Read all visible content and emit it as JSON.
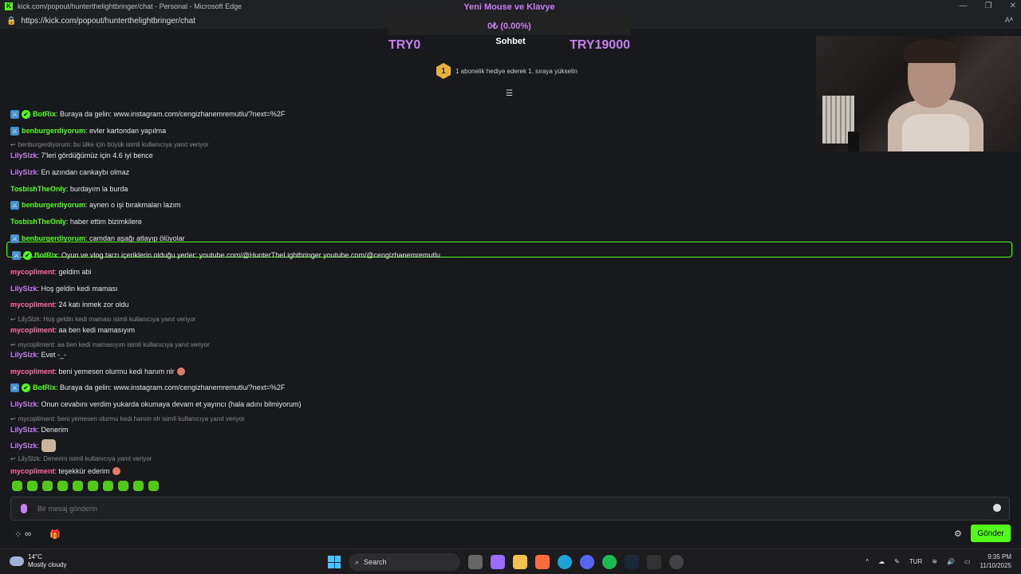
{
  "window": {
    "title": "kick.com/popout/hunterthelightbringer/chat - Personal - Microsoft Edge",
    "url": "https://kick.com/popout/hunterthelightbringer/chat"
  },
  "goal": {
    "title": "Yeni Mouse ve Klavye",
    "percent_text": "0₺ (0.00%)",
    "min_label": "TRY0",
    "max_label": "TRY19000",
    "progress": 0
  },
  "chat": {
    "title": "Sohbet",
    "sub_promo_rank": "1",
    "sub_promo_text": "1 abonelik hediye ederek 1. sıraya yükselin"
  },
  "messages": [
    {
      "user": "BotRix",
      "text": ": Buraya da gelin: www.instagram.com/cengizhanemremutlu/?next=%2F",
      "color": "#53fc18",
      "badges": [
        "mod",
        "verified"
      ]
    },
    {
      "user": "benburgerdiyorum",
      "text": ": evler kartondan yapılma",
      "color": "#53fc18",
      "badges": [
        "mod"
      ]
    },
    {
      "reply": "benburgerdiyorum: bu ülke için büyük isimli kullanıcıya yanıt veriyor"
    },
    {
      "user": "LilySlzk",
      "text": ": 7'leri gördüğümüz için 4.6 iyi bence",
      "color": "#c67ff0",
      "badges": []
    },
    {
      "user": "LilySlzk",
      "text": ": En azından cankaybı olmaz",
      "color": "#c67ff0",
      "badges": []
    },
    {
      "user": "TosbishTheOnly",
      "text": ": burdayım la burda",
      "color": "#53fc18",
      "badges": []
    },
    {
      "user": "benburgerdiyorum",
      "text": ": aynen o işi bırakmaları lazım",
      "color": "#53fc18",
      "badges": [
        "mod"
      ]
    },
    {
      "user": "TosbishTheOnly",
      "text": ": haber ettim bizimkilere",
      "color": "#53fc18",
      "badges": []
    },
    {
      "user": "benburgerdiyorum",
      "text": ": camdan aşağı atlayıp ölüyolar",
      "color": "#53fc18",
      "badges": [
        "mod"
      ]
    },
    {
      "user": "BotRix",
      "text": ": Oyun ve vlog tarzı içeriklerin olduğu yerler: youtube.com/@HunterTheLightbringer youtube.com/@cengizhanemremutlu",
      "color": "#53fc18",
      "badges": [
        "mod",
        "verified"
      ],
      "pinned": true
    },
    {
      "user": "mycopliment",
      "text": ": geldim abi",
      "color": "#ff6b9d",
      "badges": []
    },
    {
      "user": "LilySlzk",
      "text": ": Hoş geldin kedi maması",
      "color": "#c67ff0",
      "badges": []
    },
    {
      "user": "mycopliment",
      "text": ": 24 katı inmek zor oldu",
      "color": "#ff6b9d",
      "badges": []
    },
    {
      "reply": "LilySlzk: Hoş geldin kedi maması isimli kullanıcıya yanıt veriyor"
    },
    {
      "user": "mycopliment",
      "text": ": aa ben kedi mamasıyım",
      "color": "#ff6b9d",
      "badges": []
    },
    {
      "reply": "mycopliment: aa ben kedi mamasıyım isimli kullanıcıya yanıt veriyor"
    },
    {
      "user": "LilySlzk",
      "text": ": Evet -_-",
      "color": "#c67ff0",
      "badges": []
    },
    {
      "user": "mycopliment",
      "text": ": beni yemesen olurmu kedi hanım nlr",
      "color": "#ff6b9d",
      "badges": [],
      "emoji": true
    },
    {
      "user": "BotRix",
      "text": ": Buraya da gelin: www.instagram.com/cengizhanemremutlu/?next=%2F",
      "color": "#53fc18",
      "badges": [
        "mod",
        "verified"
      ]
    },
    {
      "user": "LilySlzk",
      "text": ": Onun cevabını verdim yukarda okumaya devam et yayıncı (hala adını bilmiyorum)",
      "color": "#c67ff0",
      "badges": []
    },
    {
      "reply": "mycopliment: beni yemesen olurmu kedi hanım nlr isimli kullanıcıya yanıt veriyor"
    },
    {
      "user": "LilySlzk",
      "text": ": Denerim",
      "color": "#c67ff0",
      "badges": []
    },
    {
      "user": "LilySlzk",
      "text": ":",
      "color": "#c67ff0",
      "badges": [],
      "cat": true
    },
    {
      "reply": "LilySlzk: Denerim isimli kullanıcıya yanıt veriyor"
    },
    {
      "user": "mycopliment",
      "text": ": teşekkür ederim",
      "color": "#ff6b9d",
      "badges": [],
      "emoji": true
    }
  ],
  "input": {
    "placeholder": "Bir mesaj gönderin"
  },
  "send_label": "Gönder",
  "taskbar": {
    "weather_temp": "14°C",
    "weather_desc": "Mostly cloudy",
    "search_label": "Search",
    "lang": "TUR",
    "time": "9:35 PM",
    "date": "11/10/2025"
  }
}
